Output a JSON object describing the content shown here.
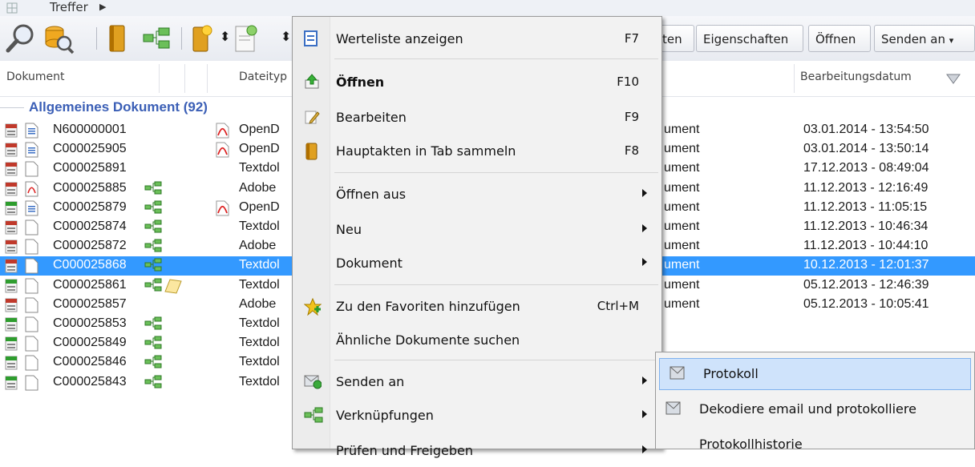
{
  "top_menu": {
    "label": "Treffer"
  },
  "toolbar": {
    "buttons": [
      {
        "label": "ten"
      },
      {
        "label": "Eigenschaften"
      },
      {
        "label": "Öffnen"
      },
      {
        "label": "Senden an"
      }
    ]
  },
  "columns": {
    "dokument": "Dokument",
    "dateityp": "Dateityp",
    "bearbeitungsdatum": "Bearbeitungsdatum"
  },
  "group": {
    "label": "Allgemeines Dokument (92)"
  },
  "rows": [
    {
      "id": "N600000001",
      "type": "OpenD",
      "kind": "ument",
      "date": "03.01.2014 - 13:54:50"
    },
    {
      "id": "C000025905",
      "type": "OpenD",
      "kind": "ument",
      "date": "03.01.2014 - 13:50:14"
    },
    {
      "id": "C000025891",
      "type": "Textdol",
      "kind": "ument",
      "date": "17.12.2013 - 08:49:04"
    },
    {
      "id": "C000025885",
      "type": "Adobe",
      "kind": "ument",
      "date": "11.12.2013 - 12:16:49"
    },
    {
      "id": "C000025879",
      "type": "OpenD",
      "kind": "ument",
      "date": "11.12.2013 - 11:05:15"
    },
    {
      "id": "C000025874",
      "type": "Textdol",
      "kind": "ument",
      "date": "11.12.2013 - 10:46:34"
    },
    {
      "id": "C000025872",
      "type": "Adobe",
      "kind": "ument",
      "date": "11.12.2013 - 10:44:10"
    },
    {
      "id": "C000025868",
      "type": "Textdol",
      "kind": "ument",
      "date": "10.12.2013 - 12:01:37"
    },
    {
      "id": "C000025861",
      "type": "Textdol",
      "kind": "ument",
      "date": "05.12.2013 - 12:46:39"
    },
    {
      "id": "C000025857",
      "type": "Adobe",
      "kind": "ument",
      "date": "05.12.2013 - 10:05:41"
    },
    {
      "id": "C000025853",
      "type": "Textdol",
      "kind": "",
      "date": ""
    },
    {
      "id": "C000025849",
      "type": "Textdol",
      "kind": "",
      "date": ""
    },
    {
      "id": "C000025846",
      "type": "Textdol",
      "kind": "",
      "date": ""
    },
    {
      "id": "C000025843",
      "type": "Textdol",
      "kind": "",
      "date": ""
    }
  ],
  "context_menu": {
    "items": [
      {
        "label": "Werteliste anzeigen",
        "shortcut": "F7"
      },
      {
        "label": "Öffnen",
        "shortcut": "F10"
      },
      {
        "label": "Bearbeiten",
        "shortcut": "F9"
      },
      {
        "label": "Hauptakten in Tab sammeln",
        "shortcut": "F8"
      },
      {
        "label": "Öffnen aus",
        "shortcut": ""
      },
      {
        "label": "Neu",
        "shortcut": ""
      },
      {
        "label": "Dokument",
        "shortcut": ""
      },
      {
        "label": "Zu den Favoriten hinzufügen",
        "shortcut": "Ctrl+M"
      },
      {
        "label": "Ähnliche Dokumente suchen",
        "shortcut": ""
      },
      {
        "label": "Senden an",
        "shortcut": ""
      },
      {
        "label": "Verknüpfungen",
        "shortcut": ""
      },
      {
        "label": "Prüfen und Freigeben",
        "shortcut": ""
      }
    ]
  },
  "submenu": {
    "items": [
      {
        "label": "Protokoll"
      },
      {
        "label": "Dekodiere email und protokolliere"
      },
      {
        "label": "Protokollhistorie"
      }
    ]
  },
  "colors": {
    "selection": "#3399ff",
    "group_header": "#3b5fb6",
    "menu_bg": "#f2f2f2",
    "submenu_highlight": "#cfe3fb"
  }
}
